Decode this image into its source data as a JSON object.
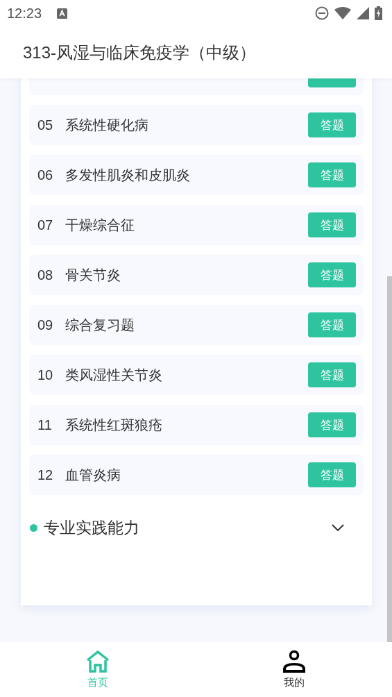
{
  "status_bar": {
    "time": "12:23"
  },
  "app_bar": {
    "title": "313-风湿与临床免疫学（中级）"
  },
  "clipped_first_row": true,
  "chapters": [
    {
      "number": "05",
      "title": "系统性硬化病",
      "button": "答题"
    },
    {
      "number": "06",
      "title": "多发性肌炎和皮肌炎",
      "button": "答题"
    },
    {
      "number": "07",
      "title": "干燥综合征",
      "button": "答题"
    },
    {
      "number": "08",
      "title": "骨关节炎",
      "button": "答题"
    },
    {
      "number": "09",
      "title": "综合复习题",
      "button": "答题"
    },
    {
      "number": "10",
      "title": "类风湿性关节炎",
      "button": "答题"
    },
    {
      "number": "11",
      "title": "系统性红斑狼疮",
      "button": "答题"
    },
    {
      "number": "12",
      "title": "血管炎病",
      "button": "答题"
    }
  ],
  "sections": [
    {
      "title": "专业实践能力",
      "expanded": false
    }
  ],
  "bottom_nav": [
    {
      "kind": "home",
      "label": "首页",
      "selected": true
    },
    {
      "kind": "profile",
      "label": "我的",
      "selected": false
    }
  ]
}
